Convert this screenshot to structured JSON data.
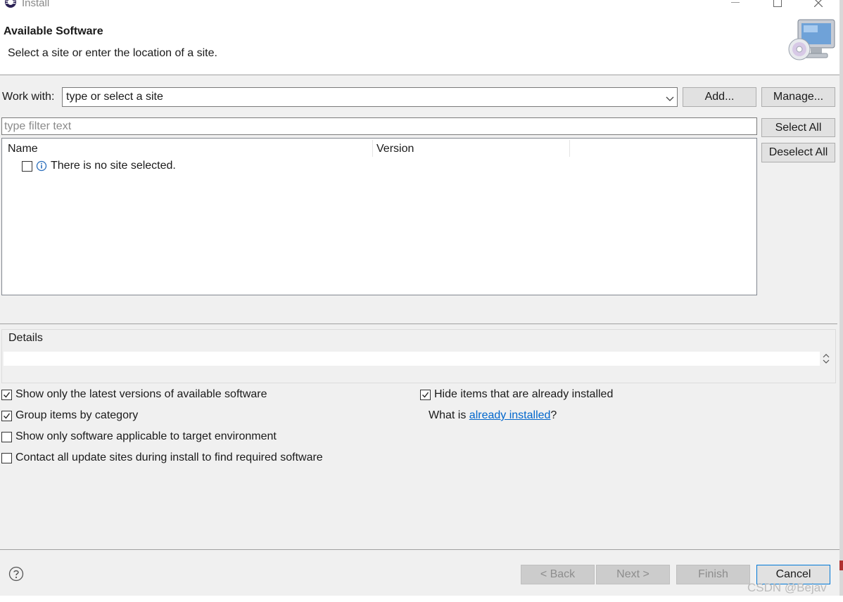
{
  "window": {
    "title": "Install",
    "icon": "eclipse-icon",
    "controls": [
      "minimize-icon",
      "maximize-icon",
      "close-icon"
    ]
  },
  "header": {
    "title": "Available Software",
    "subtitle": "Select a site or enter the location of a site.",
    "image": "monitor-cd-icon"
  },
  "work_with": {
    "label": "Work with:",
    "value": "type or select a site",
    "add_label": "Add...",
    "manage_label": "Manage..."
  },
  "filter": {
    "placeholder": "type filter text"
  },
  "selection": {
    "select_all_label": "Select All",
    "deselect_all_label": "Deselect All"
  },
  "tree": {
    "columns": [
      "Name",
      "Version"
    ],
    "rows": [
      {
        "checked": false,
        "icon": "info-icon",
        "text": "There is no site selected."
      }
    ]
  },
  "details": {
    "label": "Details",
    "value": ""
  },
  "options": {
    "show_latest": {
      "label": "Show only the latest versions of available software",
      "checked": true
    },
    "group_by_category": {
      "label": "Group items by category",
      "checked": true
    },
    "show_applicable": {
      "label": "Show only software applicable to target environment",
      "checked": false
    },
    "contact_all": {
      "label": "Contact all update sites during install to find required software",
      "checked": false
    },
    "hide_installed": {
      "label": "Hide items that are already installed",
      "checked": true
    },
    "what_is_prefix": "What is ",
    "what_is_link": "already installed",
    "what_is_suffix": "?"
  },
  "buttons": {
    "help_icon": "help-icon",
    "back_label": "< Back",
    "next_label": "Next >",
    "finish_label": "Finish",
    "cancel_label": "Cancel"
  },
  "watermark": "CSDN @Bejav",
  "colors": {
    "link": "#0066cc",
    "dialog_bg": "#f0f0f0",
    "cancel_border": "#0078d7"
  }
}
